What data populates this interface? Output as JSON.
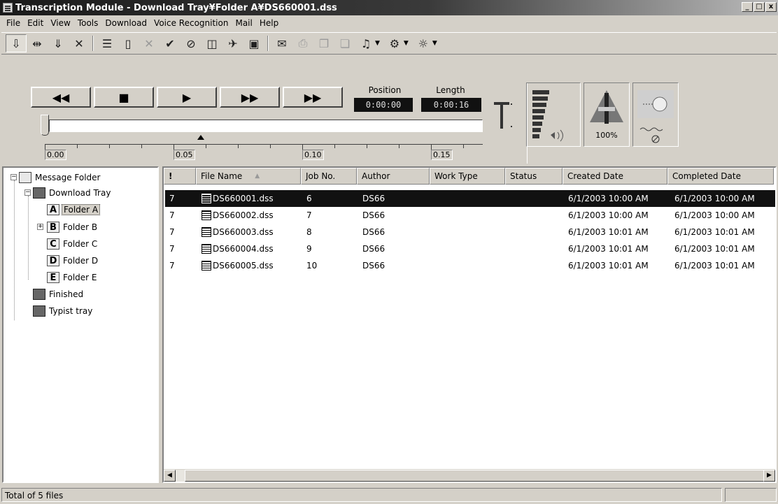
{
  "window": {
    "title": "Transcription Module - Download Tray¥Folder A¥DS660001.dss",
    "controls": [
      "_",
      "□",
      "x"
    ]
  },
  "menu": [
    "File",
    "Edit",
    "View",
    "Tools",
    "Download",
    "Voice Recognition",
    "Mail",
    "Help"
  ],
  "player": {
    "buttons": [
      "◀◀",
      "■",
      "▶",
      "▶▶",
      "▶▶"
    ],
    "position_label": "Position",
    "position_value": "0:00:00",
    "length_label": "Length",
    "length_value": "0:00:16",
    "ruler_labels": [
      "0.00",
      "0.05",
      "0.10",
      "0.15"
    ],
    "speed_value": "100%"
  },
  "tree": {
    "root": "Message Folder",
    "download_tray": "Download Tray",
    "folders": [
      "Folder A",
      "Folder B",
      "Folder C",
      "Folder D",
      "Folder E"
    ],
    "folder_letters": [
      "A",
      "B",
      "C",
      "D",
      "E"
    ],
    "finished": "Finished",
    "typist": "Typist tray"
  },
  "list": {
    "columns": [
      "!",
      "File Name",
      "Job No.",
      "Author",
      "Work Type",
      "Status",
      "Created Date",
      "Completed Date"
    ],
    "rows": [
      {
        "priority": "7",
        "file": "DS660001.dss",
        "job": "6",
        "author": "DS66",
        "work_type": "",
        "status": "",
        "created": "6/1/2003 10:00 AM",
        "completed": "6/1/2003 10:00 AM"
      },
      {
        "priority": "7",
        "file": "DS660002.dss",
        "job": "7",
        "author": "DS66",
        "work_type": "",
        "status": "",
        "created": "6/1/2003 10:00 AM",
        "completed": "6/1/2003 10:00 AM"
      },
      {
        "priority": "7",
        "file": "DS660003.dss",
        "job": "8",
        "author": "DS66",
        "work_type": "",
        "status": "",
        "created": "6/1/2003 10:01 AM",
        "completed": "6/1/2003 10:01 AM"
      },
      {
        "priority": "7",
        "file": "DS660004.dss",
        "job": "9",
        "author": "DS66",
        "work_type": "",
        "status": "",
        "created": "6/1/2003 10:01 AM",
        "completed": "6/1/2003 10:01 AM"
      },
      {
        "priority": "7",
        "file": "DS660005.dss",
        "job": "10",
        "author": "DS66",
        "work_type": "",
        "status": "",
        "created": "6/1/2003 10:01 AM",
        "completed": "6/1/2003 10:01 AM"
      }
    ]
  },
  "status": {
    "text": "Total of 5 files"
  }
}
